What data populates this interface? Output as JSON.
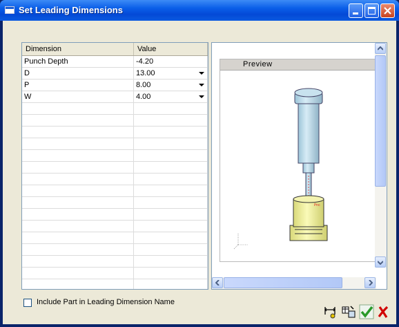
{
  "window": {
    "title": "Set Leading Dimensions"
  },
  "grid": {
    "columns": [
      "Dimension",
      "Value"
    ],
    "rows": [
      {
        "name": "Punch Depth",
        "value": "-4.20",
        "dropdown": false
      },
      {
        "name": "D",
        "value": "13.00",
        "dropdown": true
      },
      {
        "name": "P",
        "value": "8.00",
        "dropdown": true
      },
      {
        "name": "W",
        "value": "4.00",
        "dropdown": true
      }
    ],
    "empty_rows": 16
  },
  "preview": {
    "label": "Preview"
  },
  "options": {
    "include_part_label": "Include Part in Leading Dimension Name",
    "include_part_checked": false
  },
  "icons": [
    "minimize-icon",
    "maximize-icon",
    "close-icon",
    "dimension-tool-icon",
    "edit-table-icon",
    "ok-check-icon",
    "cancel-x-icon"
  ],
  "colors": {
    "titlebar": "#0a5ee8",
    "dialog_bg": "#ece9d8",
    "punch_body": "#b9dbea",
    "die_body": "#ecec9a"
  }
}
